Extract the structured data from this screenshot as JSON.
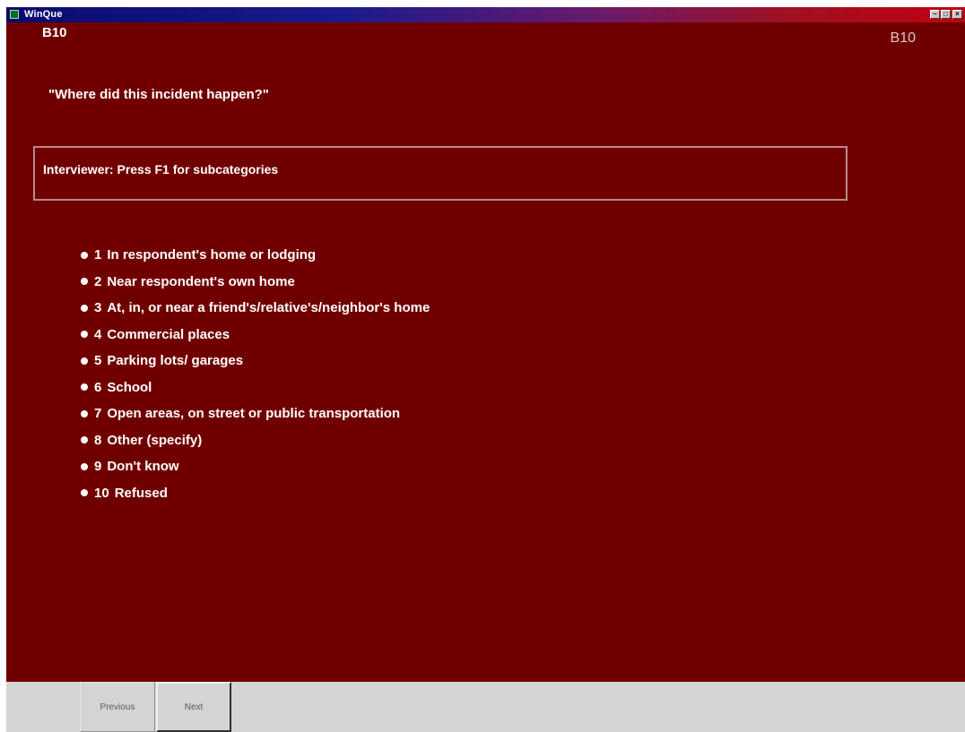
{
  "window": {
    "title": "WinQue",
    "controls": {
      "minimize_icon": "minimize-icon",
      "maximize_icon": "maximize-icon",
      "close_icon": "close-icon"
    }
  },
  "question": {
    "id_left": "B10",
    "id_right": "B10",
    "text": "\"Where did this incident happen?\"",
    "instruction": "Interviewer: Press F1 for subcategories"
  },
  "options": [
    {
      "code": "1",
      "label": "In respondent's home or lodging"
    },
    {
      "code": "2",
      "label": "Near respondent's own home"
    },
    {
      "code": "3",
      "label": "At, in, or near a friend's/relative's/neighbor's home"
    },
    {
      "code": "4",
      "label": "Commercial places"
    },
    {
      "code": "5",
      "label": "Parking lots/ garages"
    },
    {
      "code": "6",
      "label": "School"
    },
    {
      "code": "7",
      "label": "Open areas, on street or public transportation"
    },
    {
      "code": "8",
      "label": "Other (specify)"
    },
    {
      "code": "9",
      "label": "Don't know"
    },
    {
      "code": "10",
      "label": "Refused"
    }
  ],
  "navigation": {
    "previous_label": "Previous",
    "next_label": "Next"
  },
  "colors": {
    "background": "#700000",
    "titlebar_start": "#0a0a6e",
    "titlebar_end": "#c00010",
    "bottom_bar": "#d4d4d4"
  }
}
